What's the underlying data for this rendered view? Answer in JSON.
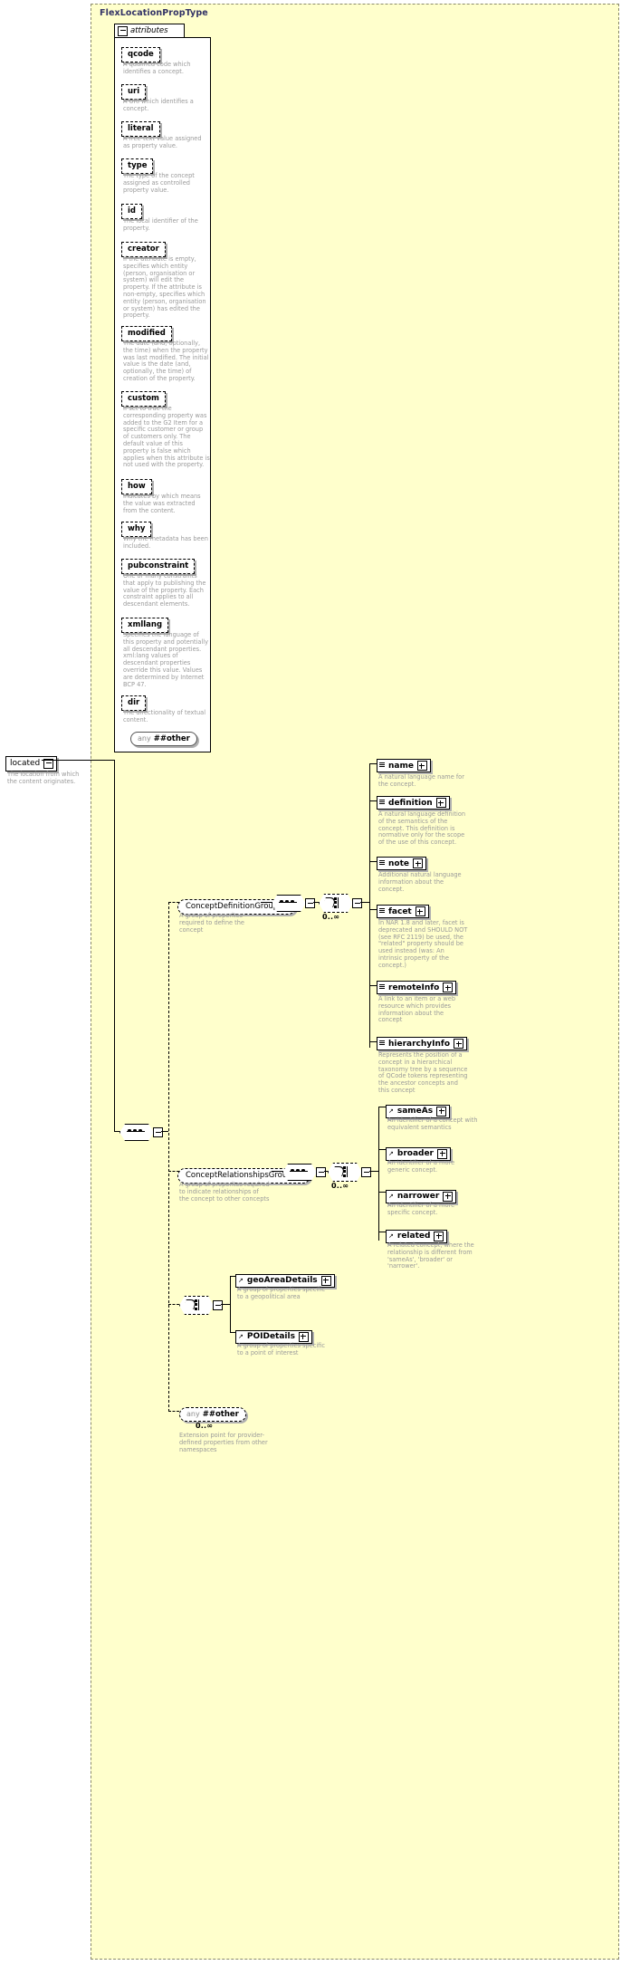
{
  "diagram": {
    "type_title": "FlexLocationPropType",
    "attributes_label": "attributes"
  },
  "root_element": {
    "name": "located",
    "annotation": "The location from which the content originates."
  },
  "attributes": [
    {
      "name": "qcode",
      "annotation": "A qualified code which identifies a concept."
    },
    {
      "name": "uri",
      "annotation": "A URI which identifies a concept."
    },
    {
      "name": "literal",
      "annotation": "A free-text value assigned as property value."
    },
    {
      "name": "type",
      "annotation": "The type of the concept assigned as controlled property value."
    },
    {
      "name": "id",
      "annotation": "The local identifier of the property."
    },
    {
      "name": "creator",
      "annotation": "If the attribute is empty, specifies which entity (person, organisation or system) will edit the property. If the attribute is non-empty, specifies which entity (person, organisation or system) has edited the property."
    },
    {
      "name": "modified",
      "annotation": "The date (and, optionally, the time) when the property was last modified. The initial value is the date (and, optionally, the time) of creation of the property."
    },
    {
      "name": "custom",
      "annotation": "If set to true the corresponding property was added to the G2 Item for a specific customer or group of customers only. The default value of this property is false which applies when this attribute is not used with the property."
    },
    {
      "name": "how",
      "annotation": "Indicates by which means the value was extracted from the content."
    },
    {
      "name": "why",
      "annotation": "Why the metadata has been included."
    },
    {
      "name": "pubconstraint",
      "annotation": "One or many constraints that apply to publishing the value of the property. Each constraint applies to all descendant elements."
    },
    {
      "name": "xmllang",
      "annotation": "Specifies the language of this property and potentially all descendant properties. xml:lang values of descendant properties override this value. Values are determined by Internet BCP 47."
    },
    {
      "name": "dir",
      "annotation": "The directionality of textual content."
    }
  ],
  "attributes_any": {
    "prefix": "any",
    "name": "##other"
  },
  "groups": {
    "concept_definition": {
      "name": "ConceptDefinitionGroup",
      "annotation": "A group of properites required to define the concept",
      "cardinality": "0..∞",
      "children": [
        {
          "name": "name",
          "annotation": "A natural language name for the concept."
        },
        {
          "name": "definition",
          "annotation": "A natural language definition of the semantics of the concept. This definition is normative only for the scope of the use of this concept."
        },
        {
          "name": "note",
          "annotation": "Additional natural language information about the concept."
        },
        {
          "name": "facet",
          "annotation": "In NAR 1.8 and later, facet is deprecated and SHOULD NOT (see RFC 2119) be used, the \"related\" property should be used instead (was: An intrinsic property of the concept.)"
        },
        {
          "name": "remoteInfo",
          "annotation": "A link to an item or a web resource which provides information about the concept"
        },
        {
          "name": "hierarchyInfo",
          "annotation": "Represents the position of a concept in a hierarchical taxonomy tree by a sequence of QCode tokens representing the ancestor concepts and this concept"
        }
      ]
    },
    "concept_relationships": {
      "name": "ConceptRelationshipsGroup",
      "annotation": "A group of properites required to indicate relationships of the concept to other concepts",
      "cardinality": "0..∞",
      "children": [
        {
          "name": "sameAs",
          "annotation": "An identifier of a concept with equivalent semantics"
        },
        {
          "name": "broader",
          "annotation": "An identifier of a more generic concept."
        },
        {
          "name": "narrower",
          "annotation": "An identifier of a more specific concept."
        },
        {
          "name": "related",
          "annotation": "A related concept, where the relationship is different from 'sameAs', 'broader' or 'narrower'."
        }
      ]
    }
  },
  "choice_details": [
    {
      "name": "geoAreaDetails",
      "annotation": "A group of properties specific to a geopolitical area"
    },
    {
      "name": "POIDetails",
      "annotation": "A group of properties specific to a point of interest"
    }
  ],
  "extension_any": {
    "prefix": "any",
    "name": "##other",
    "cardinality": "0..∞",
    "annotation": "Extension point for provider-defined properties from other namespaces"
  }
}
